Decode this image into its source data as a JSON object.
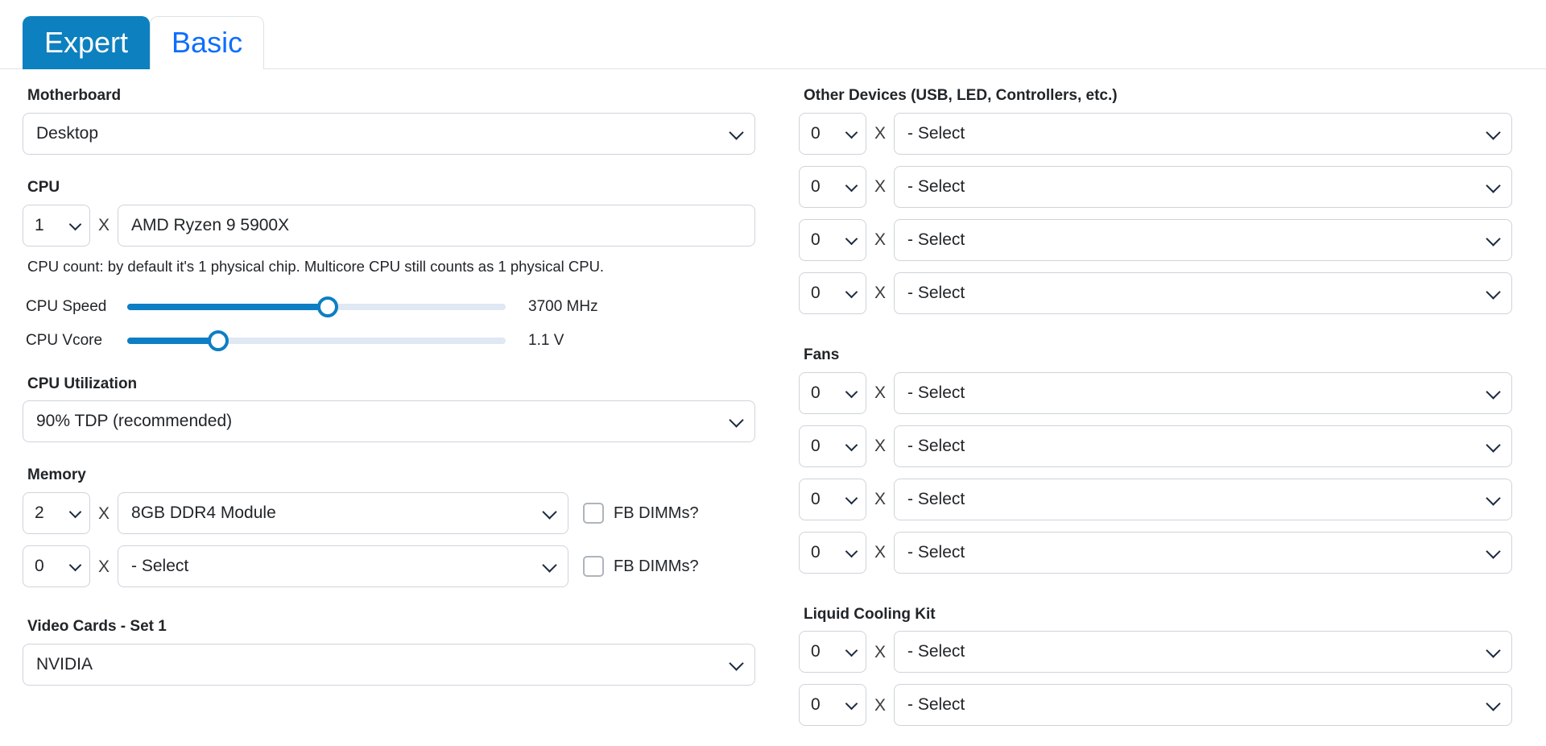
{
  "tabs": [
    {
      "label": "Expert",
      "active": true
    },
    {
      "label": "Basic",
      "active": false
    }
  ],
  "colors": {
    "tab_active_bg": "#0d80bf",
    "tab_inactive_text": "#0d6efd",
    "slider_fill": "#0d7ec4",
    "slider_track": "#dfe8f3",
    "border": "#ced4da"
  },
  "icons": {
    "chevron_down": "chevron-down-icon",
    "multiply": "X"
  },
  "left": {
    "motherboard": {
      "label": "Motherboard",
      "value": "Desktop"
    },
    "cpu": {
      "label": "CPU",
      "count": "1",
      "multiplier": "X",
      "model": "AMD Ryzen 9 5900X",
      "helper": "CPU count: by default it's 1 physical chip. Multicore CPU still counts as 1 physical CPU."
    },
    "sliders": [
      {
        "label": "CPU Speed",
        "value": "3700 MHz",
        "percent": 53
      },
      {
        "label": "CPU Vcore",
        "value": "1.1 V",
        "percent": 24
      }
    ],
    "cpu_utilization": {
      "label": "CPU Utilization",
      "value": "90% TDP (recommended)"
    },
    "memory": {
      "label": "Memory",
      "rows": [
        {
          "count": "2",
          "multiplier": "X",
          "module": "8GB DDR4 Module",
          "checkbox_label": "FB DIMMs?",
          "checked": false
        },
        {
          "count": "0",
          "multiplier": "X",
          "module": "- Select",
          "checkbox_label": "FB DIMMs?",
          "checked": false
        }
      ]
    },
    "video_cards": {
      "label": "Video Cards - Set 1",
      "value": "NVIDIA"
    }
  },
  "right": {
    "other_devices": {
      "label": "Other Devices (USB, LED, Controllers, etc.)",
      "rows": [
        {
          "count": "0",
          "multiplier": "X",
          "device": "- Select"
        },
        {
          "count": "0",
          "multiplier": "X",
          "device": "- Select"
        },
        {
          "count": "0",
          "multiplier": "X",
          "device": "- Select"
        },
        {
          "count": "0",
          "multiplier": "X",
          "device": "- Select"
        }
      ]
    },
    "fans": {
      "label": "Fans",
      "rows": [
        {
          "count": "0",
          "multiplier": "X",
          "device": "- Select"
        },
        {
          "count": "0",
          "multiplier": "X",
          "device": "- Select"
        },
        {
          "count": "0",
          "multiplier": "X",
          "device": "- Select"
        },
        {
          "count": "0",
          "multiplier": "X",
          "device": "- Select"
        }
      ]
    },
    "liquid_cooling": {
      "label": "Liquid Cooling Kit",
      "rows": [
        {
          "count": "0",
          "multiplier": "X",
          "device": "- Select"
        },
        {
          "count": "0",
          "multiplier": "X",
          "device": "- Select"
        }
      ]
    }
  }
}
